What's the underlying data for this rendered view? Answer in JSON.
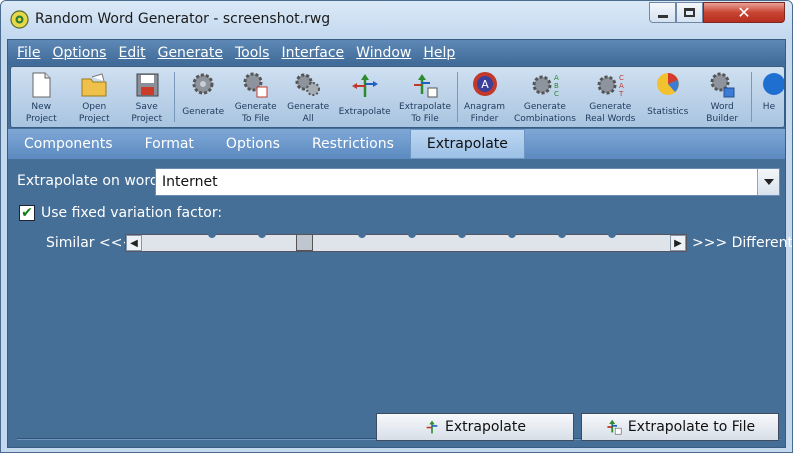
{
  "window": {
    "title": "Random Word Generator - screenshot.rwg",
    "icon": "app-icon"
  },
  "menubar": [
    "File",
    "Options",
    "Edit",
    "Generate",
    "Tools",
    "Interface",
    "Window",
    "Help"
  ],
  "toolbar": [
    {
      "label": "New\nProject",
      "icon": "new-project-icon"
    },
    {
      "label": "Open\nProject",
      "icon": "open-project-icon"
    },
    {
      "label": "Save\nProject",
      "icon": "save-project-icon"
    },
    {
      "label": "Generate",
      "icon": "generate-icon"
    },
    {
      "label": "Generate\nTo File",
      "icon": "generate-to-file-icon"
    },
    {
      "label": "Generate\nAll",
      "icon": "generate-all-icon"
    },
    {
      "label": "Extrapolate",
      "icon": "extrapolate-icon"
    },
    {
      "label": "Extrapolate\nTo File",
      "icon": "extrapolate-to-file-icon"
    },
    {
      "label": "Anagram\nFinder",
      "icon": "anagram-finder-icon"
    },
    {
      "label": "Generate\nCombinations",
      "icon": "generate-combinations-icon"
    },
    {
      "label": "Generate\nReal Words",
      "icon": "generate-real-words-icon"
    },
    {
      "label": "Statistics",
      "icon": "statistics-icon"
    },
    {
      "label": "Word\nBuilder",
      "icon": "word-builder-icon"
    },
    {
      "label": "He",
      "icon": "help-icon"
    }
  ],
  "tabs": [
    {
      "label": "Components",
      "active": false
    },
    {
      "label": "Format",
      "active": false
    },
    {
      "label": "Options",
      "active": false
    },
    {
      "label": "Restrictions",
      "active": false
    },
    {
      "label": "Extrapolate",
      "active": true
    }
  ],
  "extrapolate": {
    "word_label": "Extrapolate on word:",
    "word_value": "Internet",
    "fixed_variation_label": "Use fixed variation factor:",
    "fixed_variation_checked": true,
    "similar_label": "Similar <<<",
    "different_label": ">>> Different",
    "variation_fraction": 0.33,
    "extrapolate_button": "Extrapolate",
    "extrapolate_to_file_button": "Extrapolate to File"
  },
  "colors": {
    "panel": "#466f98",
    "menubar": "#3f6a97",
    "tab_active": "#aacbeb",
    "close": "#c84433"
  }
}
